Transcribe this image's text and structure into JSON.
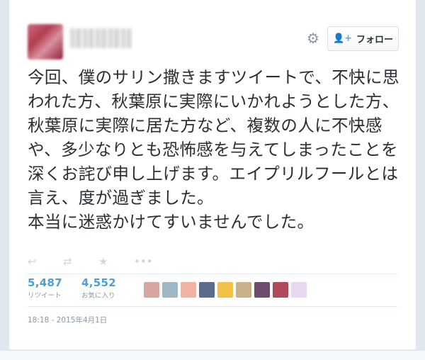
{
  "header": {
    "follow_label": "フォロー",
    "gear_glyph": "⚙",
    "person_glyph": "👤+"
  },
  "tweet": {
    "text": "今回、僕のサリン撒きますツイートで、不快に思われた方、秋葉原に実際にいかれようとした方、秋葉原に実際に居た方など、複数の人に不快感や、多少なりとも恐怖感を与えてしまったことを深くお詫び申し上げます。エイプリルフールとは言え、度が過ぎました。\n本当に迷惑かけてすいませんでした。"
  },
  "actions": {
    "reply_glyph": "↩",
    "retweet_glyph": "⇄",
    "favorite_glyph": "★",
    "more_glyph": "•••"
  },
  "stats": {
    "retweets_count": "5,487",
    "retweets_label": "リツイート",
    "favorites_count": "4,552",
    "favorites_label": "お気に入り"
  },
  "favoriters": [
    {
      "color": "#d9a5a0"
    },
    {
      "color": "#9fb8c6"
    },
    {
      "color": "#f0b3a3"
    },
    {
      "color": "#5b6b8c"
    },
    {
      "color": "#f3c14a"
    },
    {
      "color": "#c9b28a"
    },
    {
      "color": "#6f4c6f"
    },
    {
      "color": "#b04a5a"
    },
    {
      "color": "#e9d6ef"
    }
  ],
  "timestamp": "18:18 - 2015年4月1日",
  "colors": {
    "accent": "#55acee",
    "stat_number": "#4b9fd7",
    "muted": "#8899a6",
    "text": "#292f33"
  }
}
